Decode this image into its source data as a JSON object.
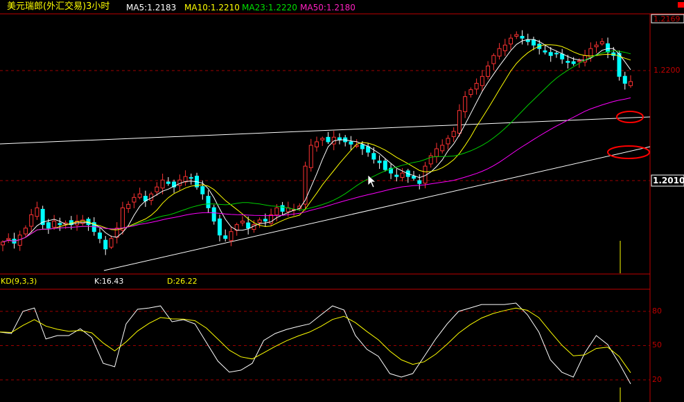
{
  "header": {
    "title": "美元瑞郎(外汇交易)3小时",
    "ma5": "MA5:1.2183",
    "ma10": "MA10:1.2210",
    "ma23": "MA23:1.2220",
    "ma50": "MA50:1.2180"
  },
  "colors": {
    "up": "#ff3232",
    "down": "#00ffff",
    "ma5": "#ffffff",
    "ma10": "#ffff00",
    "ma23": "#00d000",
    "ma50": "#ff00ff",
    "grid": "#a00000"
  },
  "chart_data": [
    {
      "type": "candlestick",
      "title": "美元瑞郎(外汇交易)3小时",
      "ylim": [
        1.187,
        1.229
      ],
      "y_ticks": [
        "1.2169",
        "1.2200",
        "1.2010"
      ],
      "current_price_label": "1.2010",
      "moving_averages": [
        5,
        10,
        23,
        50
      ],
      "closes": [
        1.1904,
        1.191,
        1.1902,
        1.1916,
        1.1928,
        1.1951,
        1.1963,
        1.1934,
        1.1928,
        1.194,
        1.1934,
        1.1937,
        1.1934,
        1.194,
        1.1942,
        1.1934,
        1.1922,
        1.191,
        1.1892,
        1.191,
        1.1928,
        1.1963,
        1.1969,
        1.1981,
        1.1987,
        1.1975,
        1.1987,
        1.1999,
        1.2011,
        1.2005,
        1.1999,
        1.2011,
        1.2017,
        1.2014,
        1.1999,
        1.1987,
        1.1963,
        1.194,
        1.1916,
        1.191,
        1.1922,
        1.1934,
        1.194,
        1.1928,
        1.1934,
        1.1942,
        1.194,
        1.1951,
        1.1963,
        1.1957,
        1.1963,
        1.196,
        1.1966,
        1.2035,
        1.2071,
        1.2077,
        1.2083,
        1.2077,
        1.2085,
        1.208,
        1.2077,
        1.2073,
        1.2071,
        1.2065,
        1.2059,
        1.2047,
        1.2041,
        1.2029,
        1.2023,
        1.2017,
        1.2023,
        1.2017,
        1.2014,
        1.2005,
        1.2035,
        1.2053,
        1.2065,
        1.2071,
        1.2083,
        1.2095,
        1.2131,
        1.2155,
        1.2167,
        1.2178,
        1.219,
        1.2208,
        1.2226,
        1.2238,
        1.2244,
        1.2256,
        1.2262,
        1.2256,
        1.225,
        1.2244,
        1.2238,
        1.2232,
        1.2226,
        1.2229,
        1.222,
        1.2214,
        1.2212,
        1.2217,
        1.2226,
        1.2238,
        1.2244,
        1.225,
        1.2232,
        1.2226,
        1.219,
        1.2178,
        1.2181
      ]
    },
    {
      "type": "line",
      "title": "KD(9,3,3)",
      "k_label": "K:16.43",
      "d_label": "D:26.22",
      "ylim": [
        10,
        100
      ],
      "y_ticks": [
        "80",
        "50",
        "20"
      ],
      "series": [
        {
          "name": "K",
          "values": [
            61.8,
            60.6,
            80,
            83,
            55.8,
            58.8,
            58.8,
            64.8,
            57,
            34.5,
            31.5,
            69,
            81.8,
            83,
            84.8,
            70.9,
            72.7,
            69,
            52.7,
            36.4,
            26.7,
            28.5,
            34.5,
            54.5,
            60.6,
            64.2,
            66.7,
            69,
            77,
            84.8,
            81.2,
            58.8,
            46.7,
            40.6,
            25.5,
            22.4,
            25.5,
            40.6,
            55.8,
            69,
            80,
            83,
            86,
            86,
            86,
            87.3,
            77,
            61.8,
            37.6,
            26.7,
            22.4,
            43.6,
            58.8,
            50.9,
            34.5,
            16.43
          ]
        },
        {
          "name": "D",
          "values": [
            62,
            61.5,
            67.7,
            72.8,
            67.1,
            64.3,
            62.5,
            63.3,
            61.2,
            52.3,
            45.4,
            53.3,
            62.8,
            69.5,
            74.6,
            73.4,
            73.2,
            71.8,
            65.4,
            55.7,
            46,
            40.2,
            38.3,
            43.7,
            49.3,
            54.3,
            58.4,
            61.9,
            66.9,
            72.9,
            75.7,
            70.1,
            62.3,
            55.1,
            45.2,
            37.6,
            33.6,
            35.9,
            42.5,
            51.3,
            60.9,
            68.3,
            74.2,
            78.1,
            80.7,
            82.9,
            80.9,
            74.5,
            62.2,
            50.4,
            41.1,
            41.9,
            47.5,
            48.6,
            40.5,
            26.22
          ]
        }
      ]
    }
  ]
}
